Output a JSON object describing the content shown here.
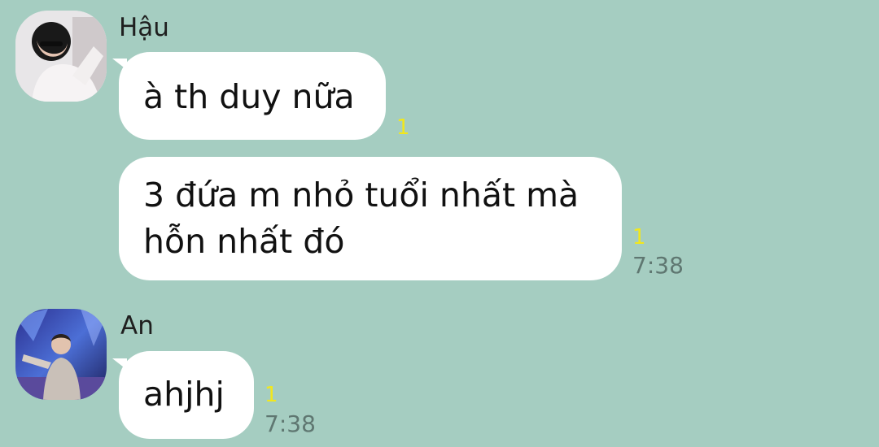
{
  "messages": [
    {
      "sender": "Hậu",
      "bubbles": [
        {
          "text": "à th duy nữa",
          "read_count": "1",
          "time": ""
        },
        {
          "text": "3 đứa m nhỏ tuổi nhất mà\nhỗn nhất đó",
          "read_count": "1",
          "time": "7:38"
        }
      ]
    },
    {
      "sender": "An",
      "bubbles": [
        {
          "text": "ahjhj",
          "read_count": "1",
          "time": "7:38"
        }
      ]
    }
  ],
  "colors": {
    "background": "#a5cdc1",
    "bubble": "#ffffff",
    "read_count": "#f2e71c",
    "timestamp": "#5f7771"
  }
}
